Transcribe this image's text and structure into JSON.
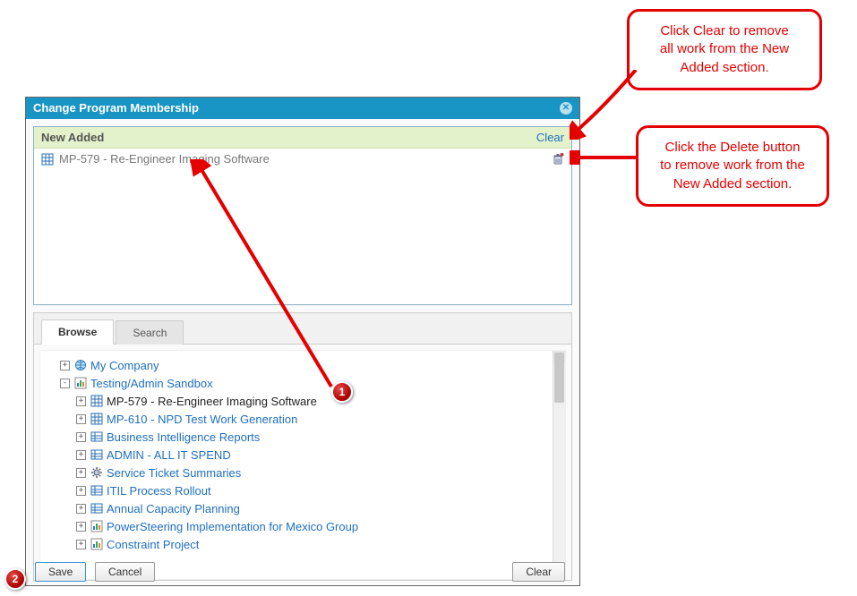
{
  "dialog": {
    "title": "Change Program Membership"
  },
  "newAdded": {
    "header": "New Added",
    "clear_label": "Clear",
    "items": [
      {
        "label": "MP-579 - Re-Engineer Imaging Software",
        "icon": "table"
      }
    ]
  },
  "tabs": {
    "browse": "Browse",
    "search": "Search",
    "active": "browse"
  },
  "tree": {
    "nodes": [
      {
        "depth": 1,
        "exp": "+",
        "icon": "globe",
        "label": "My Company"
      },
      {
        "depth": 1,
        "exp": "-",
        "icon": "chart",
        "label": "Testing/Admin Sandbox"
      },
      {
        "depth": 2,
        "exp": "+",
        "icon": "table",
        "label": "MP-579 - Re-Engineer Imaging Software",
        "selected": true
      },
      {
        "depth": 2,
        "exp": "+",
        "icon": "table",
        "label": "MP-610 - NPD Test Work Generation"
      },
      {
        "depth": 2,
        "exp": "+",
        "icon": "tablesm",
        "label": "Business Intelligence Reports"
      },
      {
        "depth": 2,
        "exp": "+",
        "icon": "tablesm",
        "label": "ADMIN - ALL IT SPEND"
      },
      {
        "depth": 2,
        "exp": "+",
        "icon": "gear",
        "label": "Service Ticket Summaries"
      },
      {
        "depth": 2,
        "exp": "+",
        "icon": "tablesm",
        "label": "ITIL Process Rollout"
      },
      {
        "depth": 2,
        "exp": "+",
        "icon": "tablesm",
        "label": "Annual Capacity Planning"
      },
      {
        "depth": 2,
        "exp": "+",
        "icon": "chart",
        "label": "PowerSteering Implementation for Mexico Group"
      },
      {
        "depth": 2,
        "exp": "+",
        "icon": "chart",
        "label": "Constraint Project"
      }
    ]
  },
  "buttons": {
    "save": "Save",
    "cancel": "Cancel",
    "clear": "Clear"
  },
  "callouts": {
    "c1_l1": "Click Clear to remove",
    "c1_l2": "all work from the New",
    "c1_l3": "Added section.",
    "c2_l1": "Click the Delete button",
    "c2_l2": "to remove work from the",
    "c2_l3": "New Added section."
  },
  "badges": {
    "b1": "1",
    "b2": "2"
  }
}
